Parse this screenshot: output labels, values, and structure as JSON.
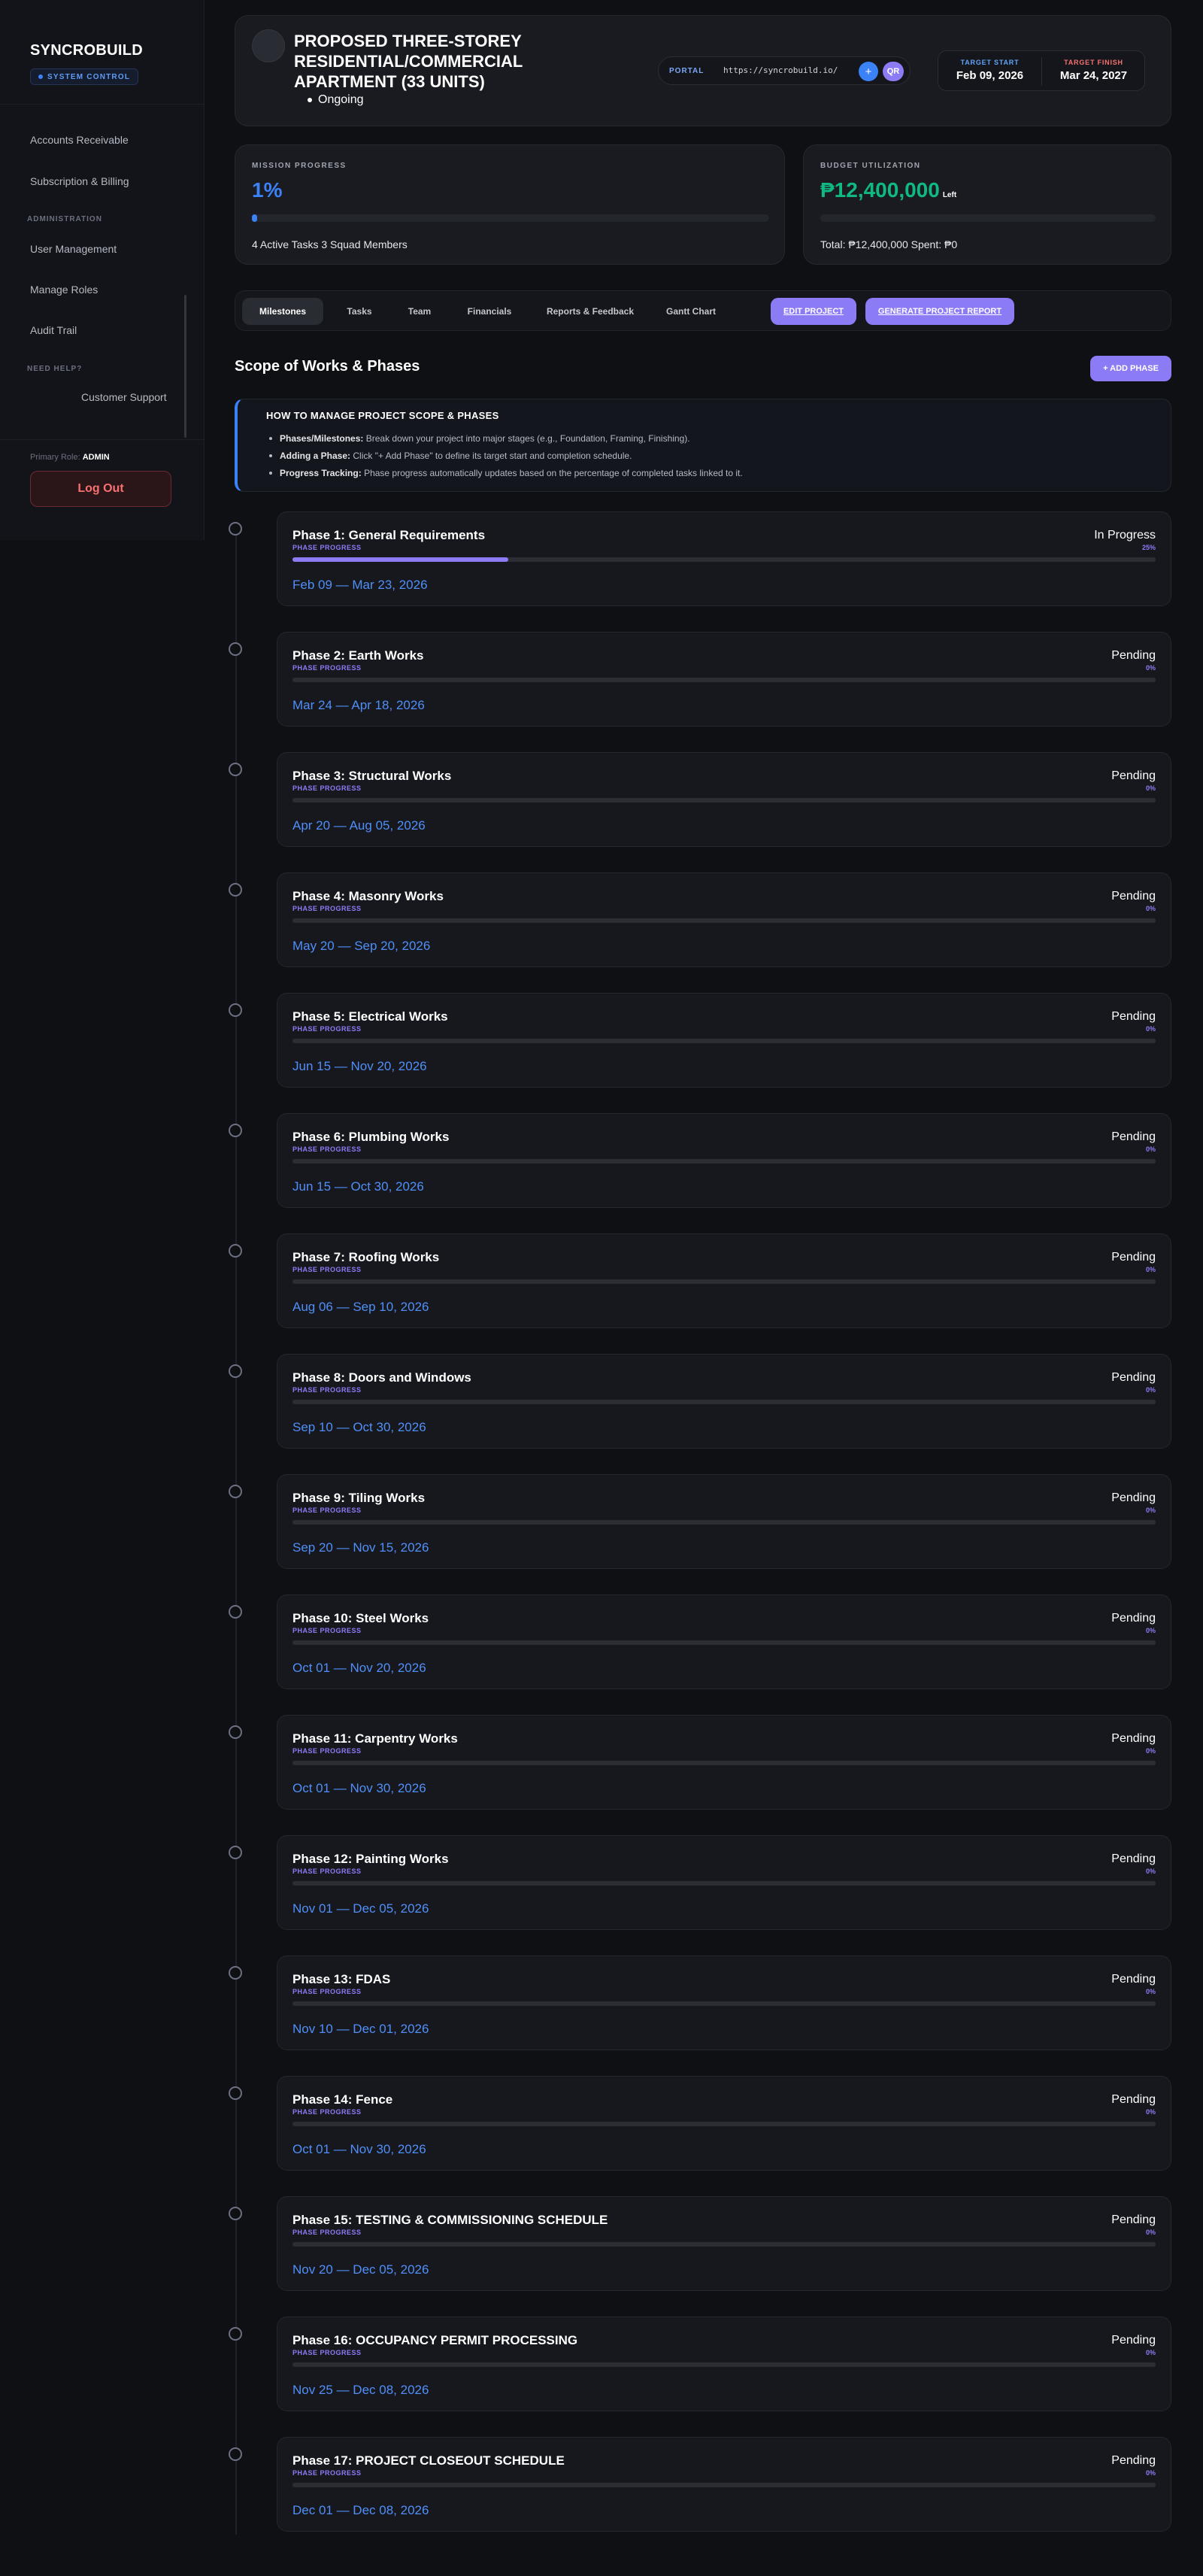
{
  "sidebar": {
    "brand": "SYNCROBUILD",
    "badge": "SYSTEM CONTROL",
    "items": [
      {
        "label": "Accounts Receivable"
      },
      {
        "label": "Subscription & Billing"
      },
      {
        "label": "User Management"
      },
      {
        "label": "Manage Roles"
      },
      {
        "label": "Audit Trail"
      }
    ],
    "section_admin": "ADMINISTRATION",
    "section_help": "NEED HELP?",
    "support_label": "Customer Support",
    "role_label": "Primary Role:",
    "role_value": "ADMIN",
    "logout_label": "Log Out"
  },
  "project": {
    "title": "PROPOSED THREE-STOREY RESIDENTIAL/COMMERCIAL APARTMENT (33 UNITS)",
    "status": "Ongoing",
    "portal_label": "PORTAL",
    "portal_url": "https://syncrobuild.io/",
    "plus_label": "+",
    "qr_label": "QR",
    "target_start_label": "TARGET START",
    "target_start": "Feb 09, 2026",
    "target_finish_label": "TARGET FINISH",
    "target_finish": "Mar 24, 2027"
  },
  "mission": {
    "label": "MISSION PROGRESS",
    "value": "1%",
    "progress_fraction": 0.01,
    "footer": "4 Active Tasks 3 Squad Members"
  },
  "budget": {
    "label": "BUDGET UTILIZATION",
    "value": "₱12,400,000",
    "unit": "Left",
    "used_fraction": 0.0,
    "footer": "Total: ₱12,400,000 Spent: ₱0"
  },
  "tabs": {
    "milestones": "Milestones",
    "tasks": "Tasks",
    "team": "Team",
    "financials": "Financials",
    "reports": "Reports & Feedback",
    "gantt": "Gantt Chart",
    "edit": "EDIT PROJECT",
    "report": "GENERATE PROJECT REPORT"
  },
  "scope": {
    "title": "Scope of Works & Phases",
    "add_label": "+ ADD PHASE",
    "help_title": "HOW TO MANAGE PROJECT SCOPE & PHASES",
    "help": [
      {
        "term": "Phases/Milestones:",
        "text": "Break down your project into major stages (e.g., Foundation, Framing, Finishing)."
      },
      {
        "term": "Adding a Phase:",
        "text": "Click \"+ Add Phase\" to define its target start and completion schedule."
      },
      {
        "term": "Progress Tracking:",
        "text": "Phase progress automatically updates based on the percentage of completed tasks linked to it."
      }
    ],
    "progress_label": "PHASE PROGRESS"
  },
  "phases": [
    {
      "name": "Phase 1: General Requirements",
      "status": "In Progress",
      "pct": "25%",
      "progress": 0.25,
      "dates": "Feb 09 — Mar 23, 2026"
    },
    {
      "name": "Phase 2: Earth Works",
      "status": "Pending",
      "pct": "0%",
      "progress": 0,
      "dates": "Mar 24 — Apr 18, 2026"
    },
    {
      "name": "Phase 3: Structural Works",
      "status": "Pending",
      "pct": "0%",
      "progress": 0,
      "dates": "Apr 20 — Aug 05, 2026"
    },
    {
      "name": "Phase 4: Masonry Works",
      "status": "Pending",
      "pct": "0%",
      "progress": 0,
      "dates": "May 20 — Sep 20, 2026"
    },
    {
      "name": "Phase 5: Electrical Works",
      "status": "Pending",
      "pct": "0%",
      "progress": 0,
      "dates": "Jun 15 — Nov 20, 2026"
    },
    {
      "name": "Phase 6: Plumbing Works",
      "status": "Pending",
      "pct": "0%",
      "progress": 0,
      "dates": "Jun 15 — Oct 30, 2026"
    },
    {
      "name": "Phase 7: Roofing Works",
      "status": "Pending",
      "pct": "0%",
      "progress": 0,
      "dates": "Aug 06 — Sep 10, 2026"
    },
    {
      "name": "Phase 8: Doors and Windows",
      "status": "Pending",
      "pct": "0%",
      "progress": 0,
      "dates": "Sep 10 — Oct 30, 2026"
    },
    {
      "name": "Phase 9: Tiling Works",
      "status": "Pending",
      "pct": "0%",
      "progress": 0,
      "dates": "Sep 20 — Nov 15, 2026"
    },
    {
      "name": "Phase 10: Steel Works",
      "status": "Pending",
      "pct": "0%",
      "progress": 0,
      "dates": "Oct 01 — Nov 20, 2026"
    },
    {
      "name": "Phase 11: Carpentry Works",
      "status": "Pending",
      "pct": "0%",
      "progress": 0,
      "dates": "Oct 01 — Nov 30, 2026"
    },
    {
      "name": "Phase 12: Painting Works",
      "status": "Pending",
      "pct": "0%",
      "progress": 0,
      "dates": "Nov 01 — Dec 05, 2026"
    },
    {
      "name": "Phase 13: FDAS",
      "status": "Pending",
      "pct": "0%",
      "progress": 0,
      "dates": "Nov 10 — Dec 01, 2026"
    },
    {
      "name": "Phase 14: Fence",
      "status": "Pending",
      "pct": "0%",
      "progress": 0,
      "dates": "Oct 01 — Nov 30, 2026"
    },
    {
      "name": "Phase 15: TESTING & COMMISSIONING SCHEDULE",
      "status": "Pending",
      "pct": "0%",
      "progress": 0,
      "dates": "Nov 20 — Dec 05, 2026"
    },
    {
      "name": "Phase 16: OCCUPANCY PERMIT PROCESSING",
      "status": "Pending",
      "pct": "0%",
      "progress": 0,
      "dates": "Nov 25 — Dec 08, 2026"
    },
    {
      "name": "Phase 17: PROJECT CLOSEOUT SCHEDULE",
      "status": "Pending",
      "pct": "0%",
      "progress": 0,
      "dates": "Dec 01 — Dec 08, 2026"
    }
  ],
  "colors": {
    "accent_blue": "#3b82f6",
    "accent_purple": "#8b7cf6",
    "budget_green": "#10b981",
    "logout_red": "#f87171",
    "finish_red": "#f87171"
  }
}
